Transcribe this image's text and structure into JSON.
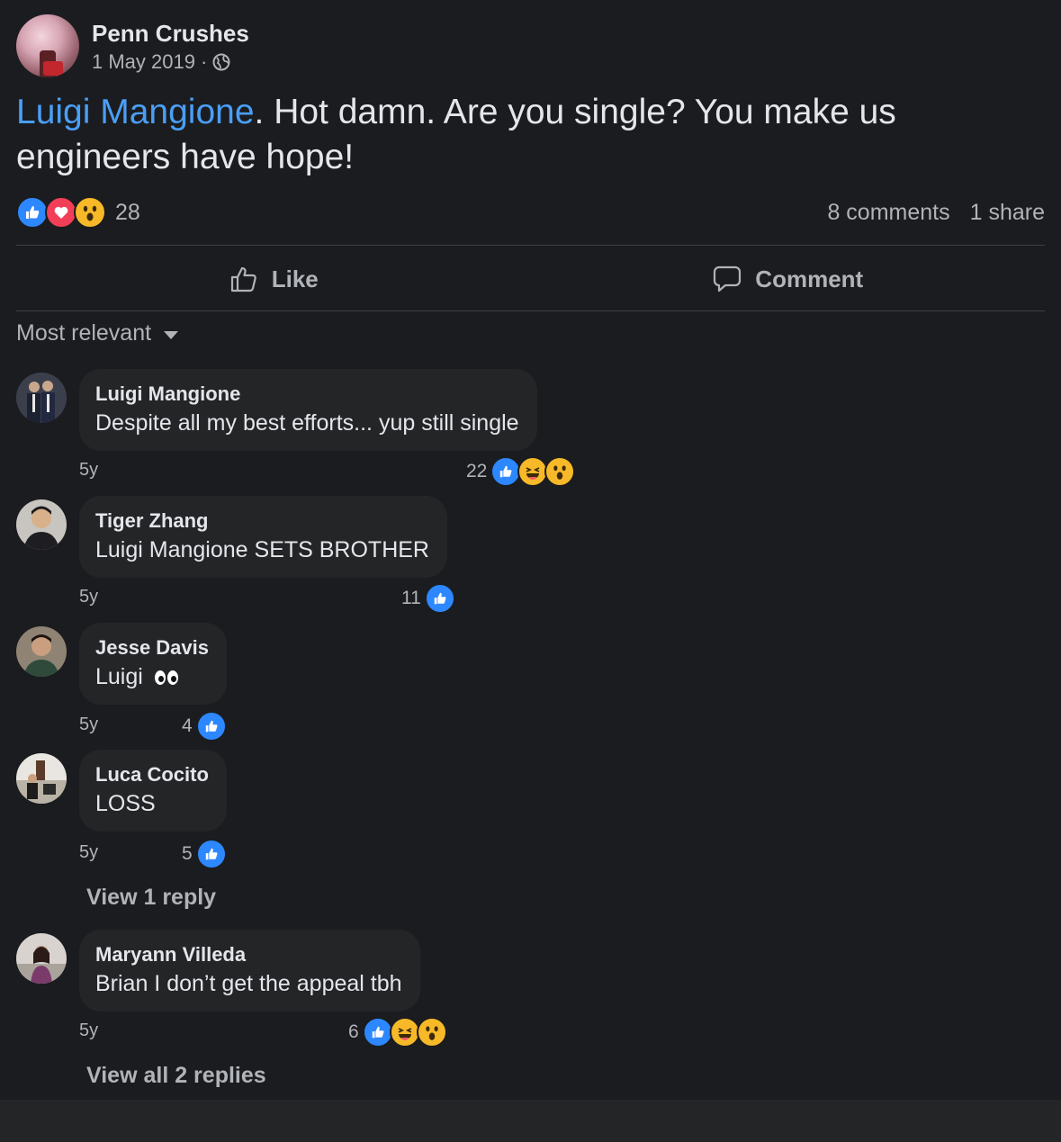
{
  "post": {
    "page_name": "Penn Crushes",
    "date": "1 May 2019",
    "meta_separator": "·",
    "mention": "Luigi Mangione",
    "text": ". Hot damn. Are you single? You make us engineers have hope!",
    "reaction_count": "28",
    "reaction_icons": [
      "like",
      "love",
      "wow"
    ],
    "comments_count": "8 comments",
    "shares_count": "1 share"
  },
  "actions": {
    "like_label": "Like",
    "comment_label": "Comment"
  },
  "sort": {
    "label": "Most relevant"
  },
  "comments": [
    {
      "author": "Luigi Mangione",
      "text": "Despite all my best efforts... yup still single",
      "time": "5y",
      "count": "22",
      "icons": [
        "like",
        "haha",
        "wow"
      ]
    },
    {
      "author": "Tiger Zhang",
      "text": "Luigi Mangione SETS BROTHER",
      "time": "5y",
      "count": "11",
      "icons": [
        "like"
      ]
    },
    {
      "author": "Jesse Davis",
      "text": "Luigi",
      "emoji": "eyes",
      "time": "5y",
      "count": "4",
      "icons": [
        "like"
      ]
    },
    {
      "author": "Luca Cocito",
      "text": "LOSS",
      "time": "5y",
      "count": "5",
      "icons": [
        "like"
      ],
      "view_replies": "View 1 reply"
    },
    {
      "author": "Maryann Villeda",
      "text": "Brian I don’t get the appeal tbh",
      "time": "5y",
      "count": "6",
      "icons": [
        "like",
        "haha",
        "wow"
      ],
      "view_replies": "View all 2 replies"
    }
  ],
  "colors": {
    "background": "#1b1c1f",
    "bubble": "#242527",
    "mention": "#4a9ef5",
    "like": "#2d88ff",
    "love": "#f33e58",
    "wow": "#f7b928"
  }
}
